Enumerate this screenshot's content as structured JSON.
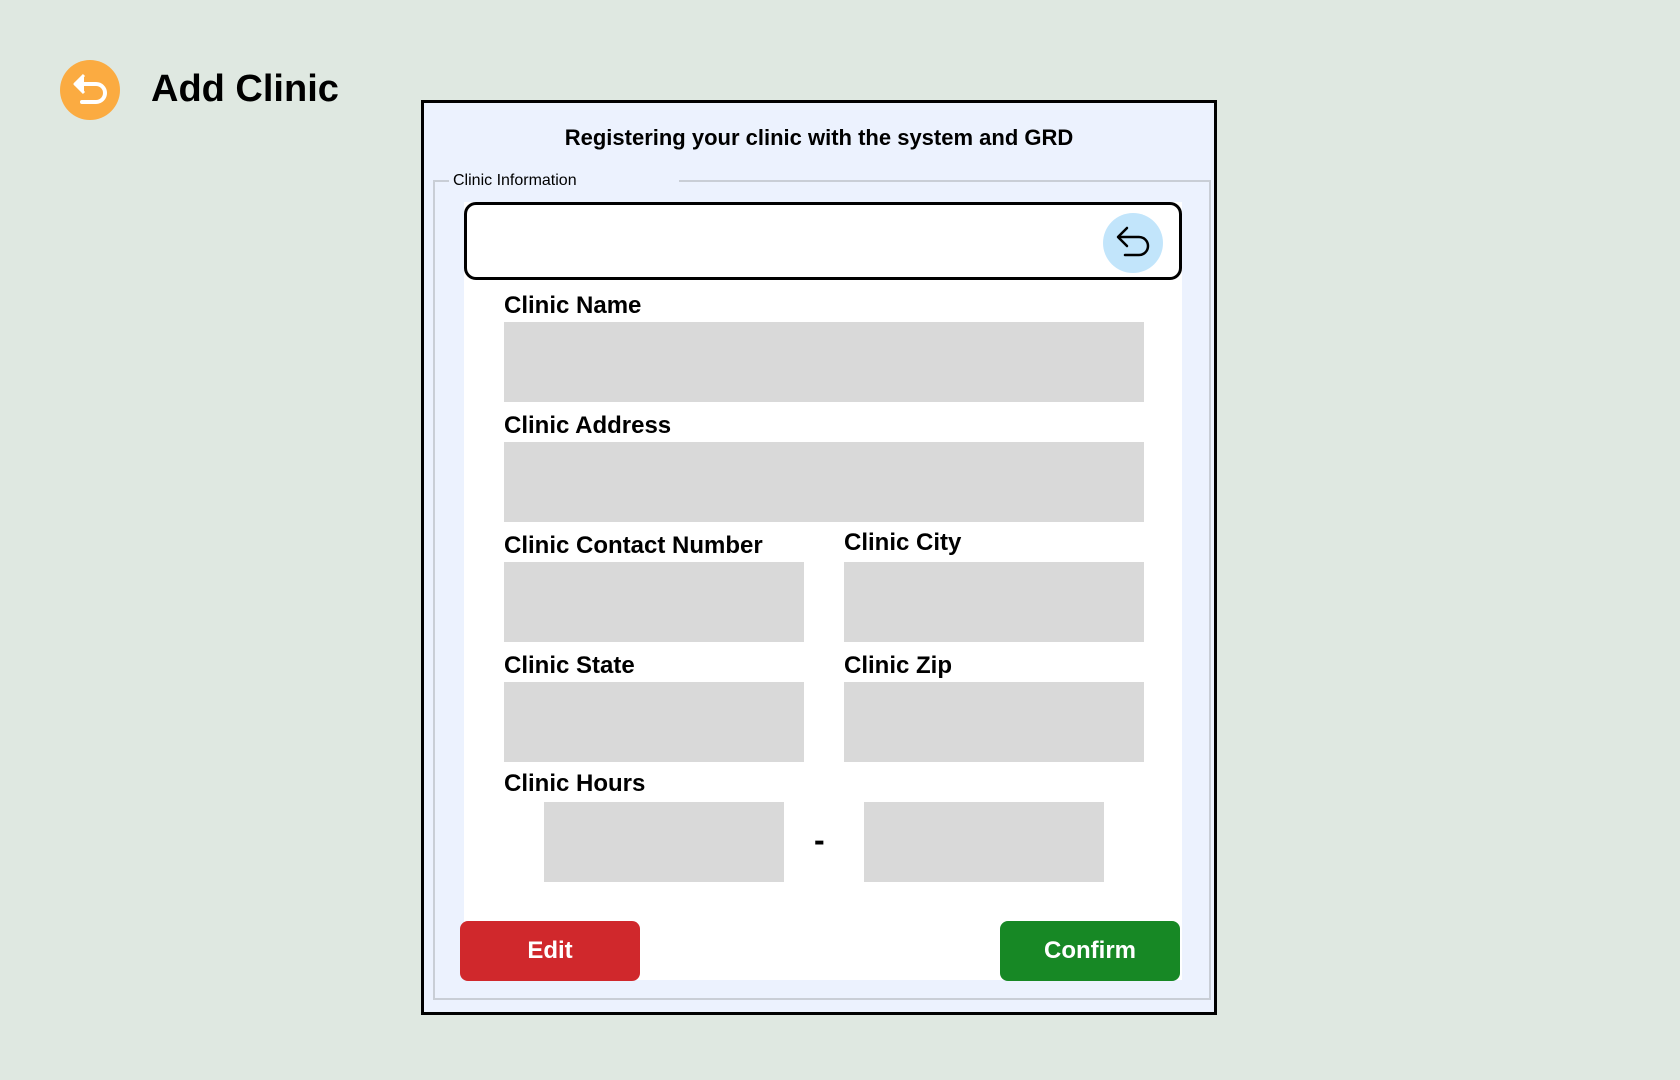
{
  "header": {
    "title": "Add Clinic",
    "back_icon": "undo-arrow-icon",
    "back_color": "#fbab41"
  },
  "panel": {
    "heading": "Registering your clinic with the system and GRD",
    "section_legend": "Clinic Information",
    "bar_back_icon": "undo-arrow-icon",
    "bar_back_color": "#c2e5fb"
  },
  "form": {
    "name_label": "Clinic Name",
    "name_value": "",
    "address_label": "Clinic Address",
    "address_value": "",
    "contact_label": "Clinic Contact Number",
    "contact_value": "",
    "city_label": "Clinic City",
    "city_value": "",
    "state_label": "Clinic State",
    "state_value": "",
    "zip_label": "Clinic Zip",
    "zip_value": "",
    "hours_label": "Clinic Hours",
    "hours_start": "",
    "hours_separator": "-",
    "hours_end": ""
  },
  "actions": {
    "edit_label": "Edit",
    "edit_color": "#d0282c",
    "confirm_label": "Confirm",
    "confirm_color": "#178825"
  }
}
